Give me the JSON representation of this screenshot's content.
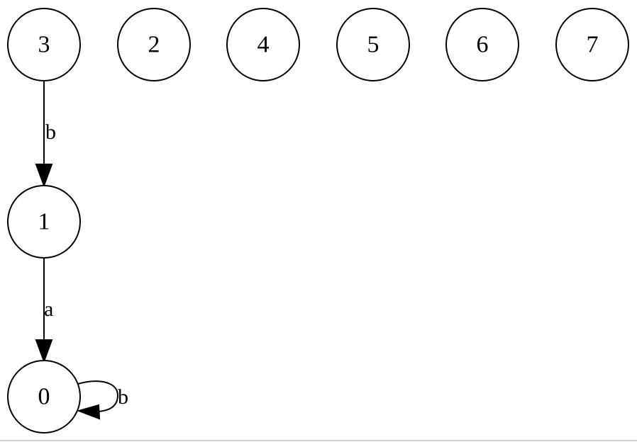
{
  "graph": {
    "nodes": [
      {
        "id": "n3",
        "label": "3"
      },
      {
        "id": "n2",
        "label": "2"
      },
      {
        "id": "n4",
        "label": "4"
      },
      {
        "id": "n5",
        "label": "5"
      },
      {
        "id": "n6",
        "label": "6"
      },
      {
        "id": "n7",
        "label": "7"
      },
      {
        "id": "n1",
        "label": "1"
      },
      {
        "id": "n0",
        "label": "0"
      }
    ],
    "edges": [
      {
        "from": "3",
        "to": "1",
        "label": "b"
      },
      {
        "from": "1",
        "to": "0",
        "label": "a"
      },
      {
        "from": "0",
        "to": "0",
        "label": "b"
      }
    ]
  },
  "colors": {
    "stroke": "#000000",
    "background": "#ffffff"
  }
}
